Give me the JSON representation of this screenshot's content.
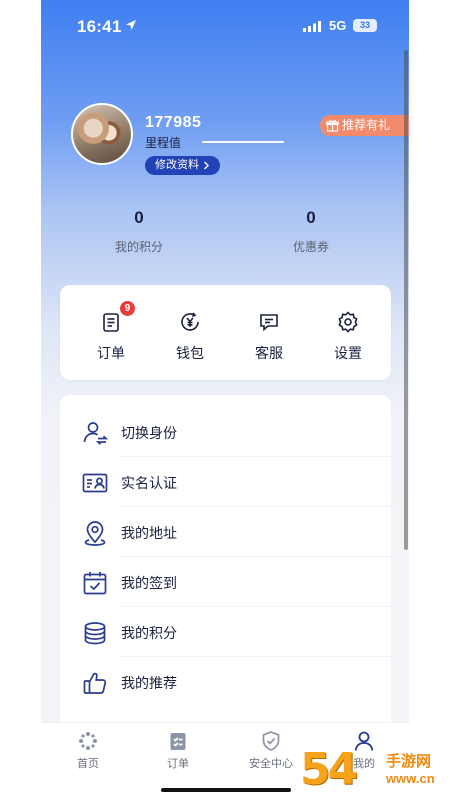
{
  "status_bar": {
    "time": "16:41",
    "network": "5G",
    "battery": "33"
  },
  "profile": {
    "username": "177985",
    "mileage_label": "里程值",
    "edit_label": "修改资料",
    "refer_label": "推荐有礼"
  },
  "stats": [
    {
      "value": "0",
      "label": "我的积分"
    },
    {
      "value": "0",
      "label": "优惠券"
    }
  ],
  "quick_actions": [
    {
      "label": "订单",
      "icon": "order-list-icon",
      "badge": "9"
    },
    {
      "label": "钱包",
      "icon": "wallet-yuan-icon"
    },
    {
      "label": "客服",
      "icon": "chat-icon"
    },
    {
      "label": "设置",
      "icon": "gear-icon"
    }
  ],
  "menu_items": [
    {
      "label": "切换身份",
      "icon": "switch-user-icon"
    },
    {
      "label": "实名认证",
      "icon": "id-card-icon"
    },
    {
      "label": "我的地址",
      "icon": "location-pin-icon"
    },
    {
      "label": "我的签到",
      "icon": "calendar-check-icon"
    },
    {
      "label": "我的积分",
      "icon": "coins-stack-icon"
    },
    {
      "label": "我的推荐",
      "icon": "thumbs-up-icon"
    }
  ],
  "tab_bar": [
    {
      "label": "首页",
      "icon": "home-logo-icon"
    },
    {
      "label": "订单",
      "icon": "clipboard-icon"
    },
    {
      "label": "安全中心",
      "icon": "shield-check-icon"
    },
    {
      "label": "我的",
      "icon": "user-icon",
      "active": true
    }
  ],
  "watermark": {
    "number": "54",
    "text": "手游网",
    "url": "www.cn"
  },
  "colors": {
    "accent": "#2342b5",
    "icon_blue": "#2a3c8f",
    "badge_red": "#e83b3b",
    "refer_orange": "#f28b6c"
  }
}
